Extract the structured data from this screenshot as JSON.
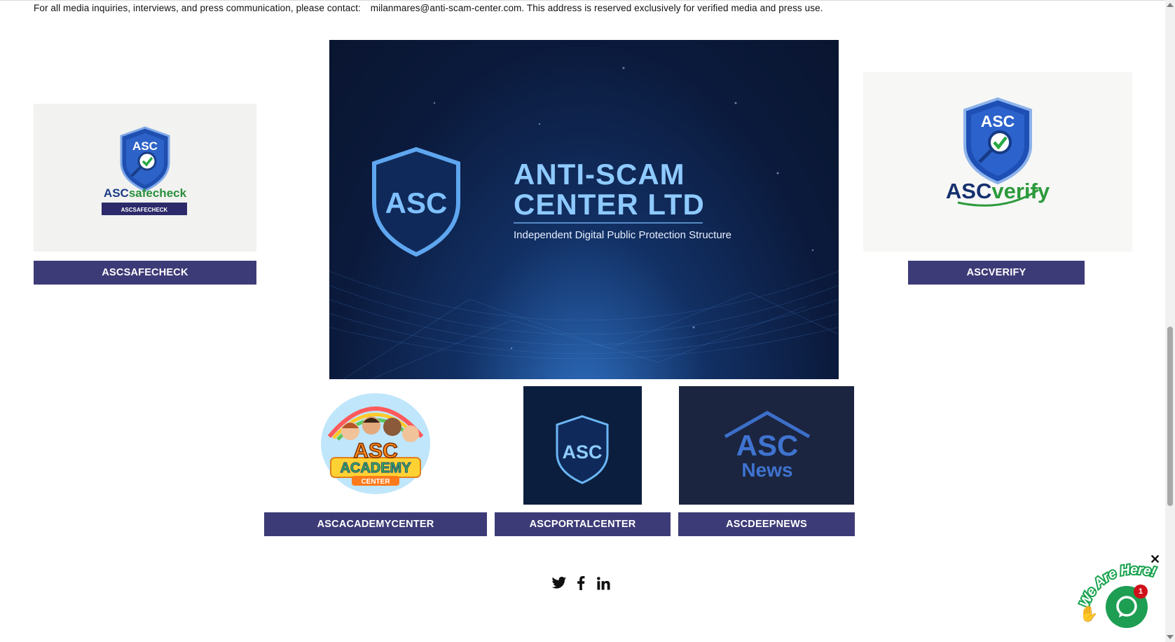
{
  "notice": {
    "text": "For all media inquiries, interviews, and press communication, please contact:",
    "email": "milanmares@anti-scam-center.com.",
    "tail": "This address is reserved exclusively for verified media and press use."
  },
  "hero": {
    "badge": "ASC",
    "title_line1": "ANTI-SCAM",
    "title_line2": "CENTER LTD",
    "subtitle": "Independent Digital Public Protection Structure"
  },
  "cards": {
    "safecheck": {
      "logo_badge": "ASC",
      "logo_text_a": "ASC",
      "logo_text_b": "safecheck",
      "logo_strip": "ASCSAFECHECK",
      "button": "ASCSAFECHECK"
    },
    "verify": {
      "logo_badge": "ASC",
      "logo_text_a": "ASC",
      "logo_text_b": "verify",
      "button": "ASCVERIFY"
    },
    "academy": {
      "logo_line1": "ASC",
      "logo_line2": "ACADEMY",
      "logo_line3": "CENTER",
      "button": "ASCACADEMYCENTER"
    },
    "portal": {
      "logo_badge": "ASC",
      "button": "ASCPORTALCENTER"
    },
    "news": {
      "logo_line1": "ASC",
      "logo_line2": "News",
      "button": "ASCDEEPNEWS"
    }
  },
  "social": {
    "icons": [
      "twitter-icon",
      "facebook-icon",
      "linkedin-icon"
    ]
  },
  "chat": {
    "label": "We Are Here!",
    "badge_count": "1",
    "close": "✕"
  },
  "colors": {
    "button_bg": "#3d3b77",
    "hero_bg": "#0d1a3a",
    "chat_green": "#1d9e53"
  }
}
